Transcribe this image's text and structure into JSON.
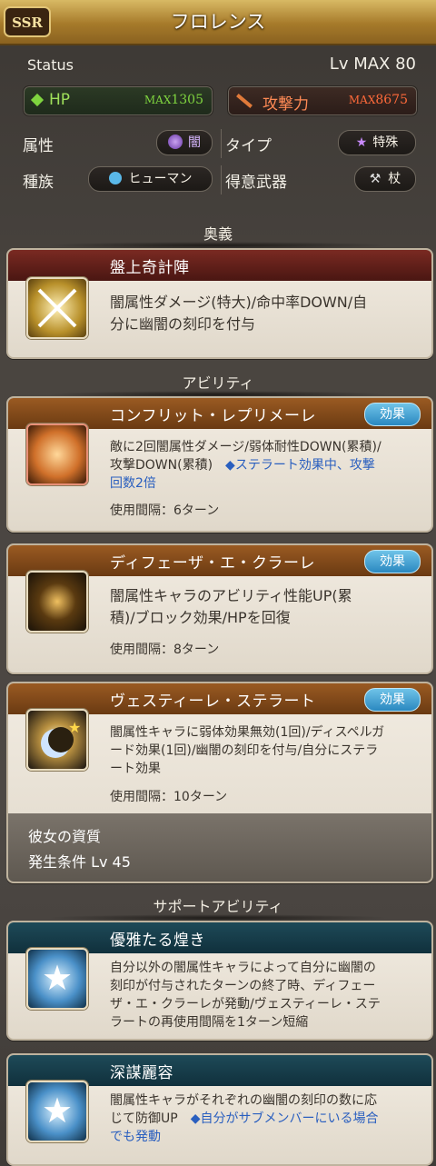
{
  "header": {
    "badge": "SSR",
    "title": "フロレンス"
  },
  "status": {
    "label": "Status",
    "level": "Lv MAX 80"
  },
  "stats": {
    "hp": {
      "name": "HP",
      "max_prefix": "MAX",
      "value": "1305",
      "color": "#7fd43f"
    },
    "atk": {
      "name": "攻撃力",
      "max_prefix": "MAX",
      "value": "8675",
      "color": "#ff6a3a"
    }
  },
  "info": {
    "element_label": "属性",
    "element_value": "闇",
    "type_label": "タイプ",
    "type_value": "特殊",
    "race_label": "種族",
    "race_value": "ヒューマン",
    "weapon_label": "得意武器",
    "weapon_value": "杖"
  },
  "sections": {
    "ougi": "奥義",
    "abilities": "アビリティ",
    "support": "サポートアビリティ"
  },
  "ougi": {
    "name": "盤上奇計陣",
    "desc1": "闇属性ダメージ(特大)/命中率DOWN/自",
    "desc2": "分に幽闇の刻印を付与"
  },
  "abilities": [
    {
      "name": "コンフリット・レプリメーレ",
      "effect": "効果",
      "desc1": "敵に2回闇属性ダメージ/弱体耐性DOWN(累積)/",
      "desc2": "攻撃DOWN(累積)",
      "desc2b": "◆ステラート効果中、攻撃",
      "desc3": "回数2倍",
      "cooldown": "使用間隔：6ターン"
    },
    {
      "name": "ディフェーザ・エ・クラーレ",
      "effect": "効果",
      "desc1": "闇属性キャラのアビリティ性能UP(累",
      "desc2": "積)/ブロック効果/HPを回復",
      "cooldown": "使用間隔：8ターン"
    },
    {
      "name": "ヴェスティーレ・ステラート",
      "effect": "効果",
      "desc1": "闇属性キャラに弱体効果無効(1回)/ディスペルガ",
      "desc2": "ード効果(1回)/幽闇の刻印を付与/自分にステラ",
      "desc3": "ート効果",
      "cooldown": "使用間隔：10ターン"
    }
  ],
  "trait": {
    "line1": "彼女の資質",
    "line2": "発生条件 Lv 45"
  },
  "support": [
    {
      "name": "優雅たる煌き",
      "desc1": "自分以外の闇属性キャラによって自分に幽闇の",
      "desc2": "刻印が付与されたターンの終了時、ディフェー",
      "desc3": "ザ・エ・クラーレが発動/ヴェスティーレ・ステ",
      "desc4": "ラートの再使用間隔を1ターン短縮"
    },
    {
      "name": "深謀麗容",
      "desc1": "闇属性キャラがそれぞれの幽闇の刻印の数に応",
      "desc2": "じて防御UP",
      "desc2b": "◆自分がサブメンバーにいる場合",
      "desc3": "でも発動"
    }
  ]
}
